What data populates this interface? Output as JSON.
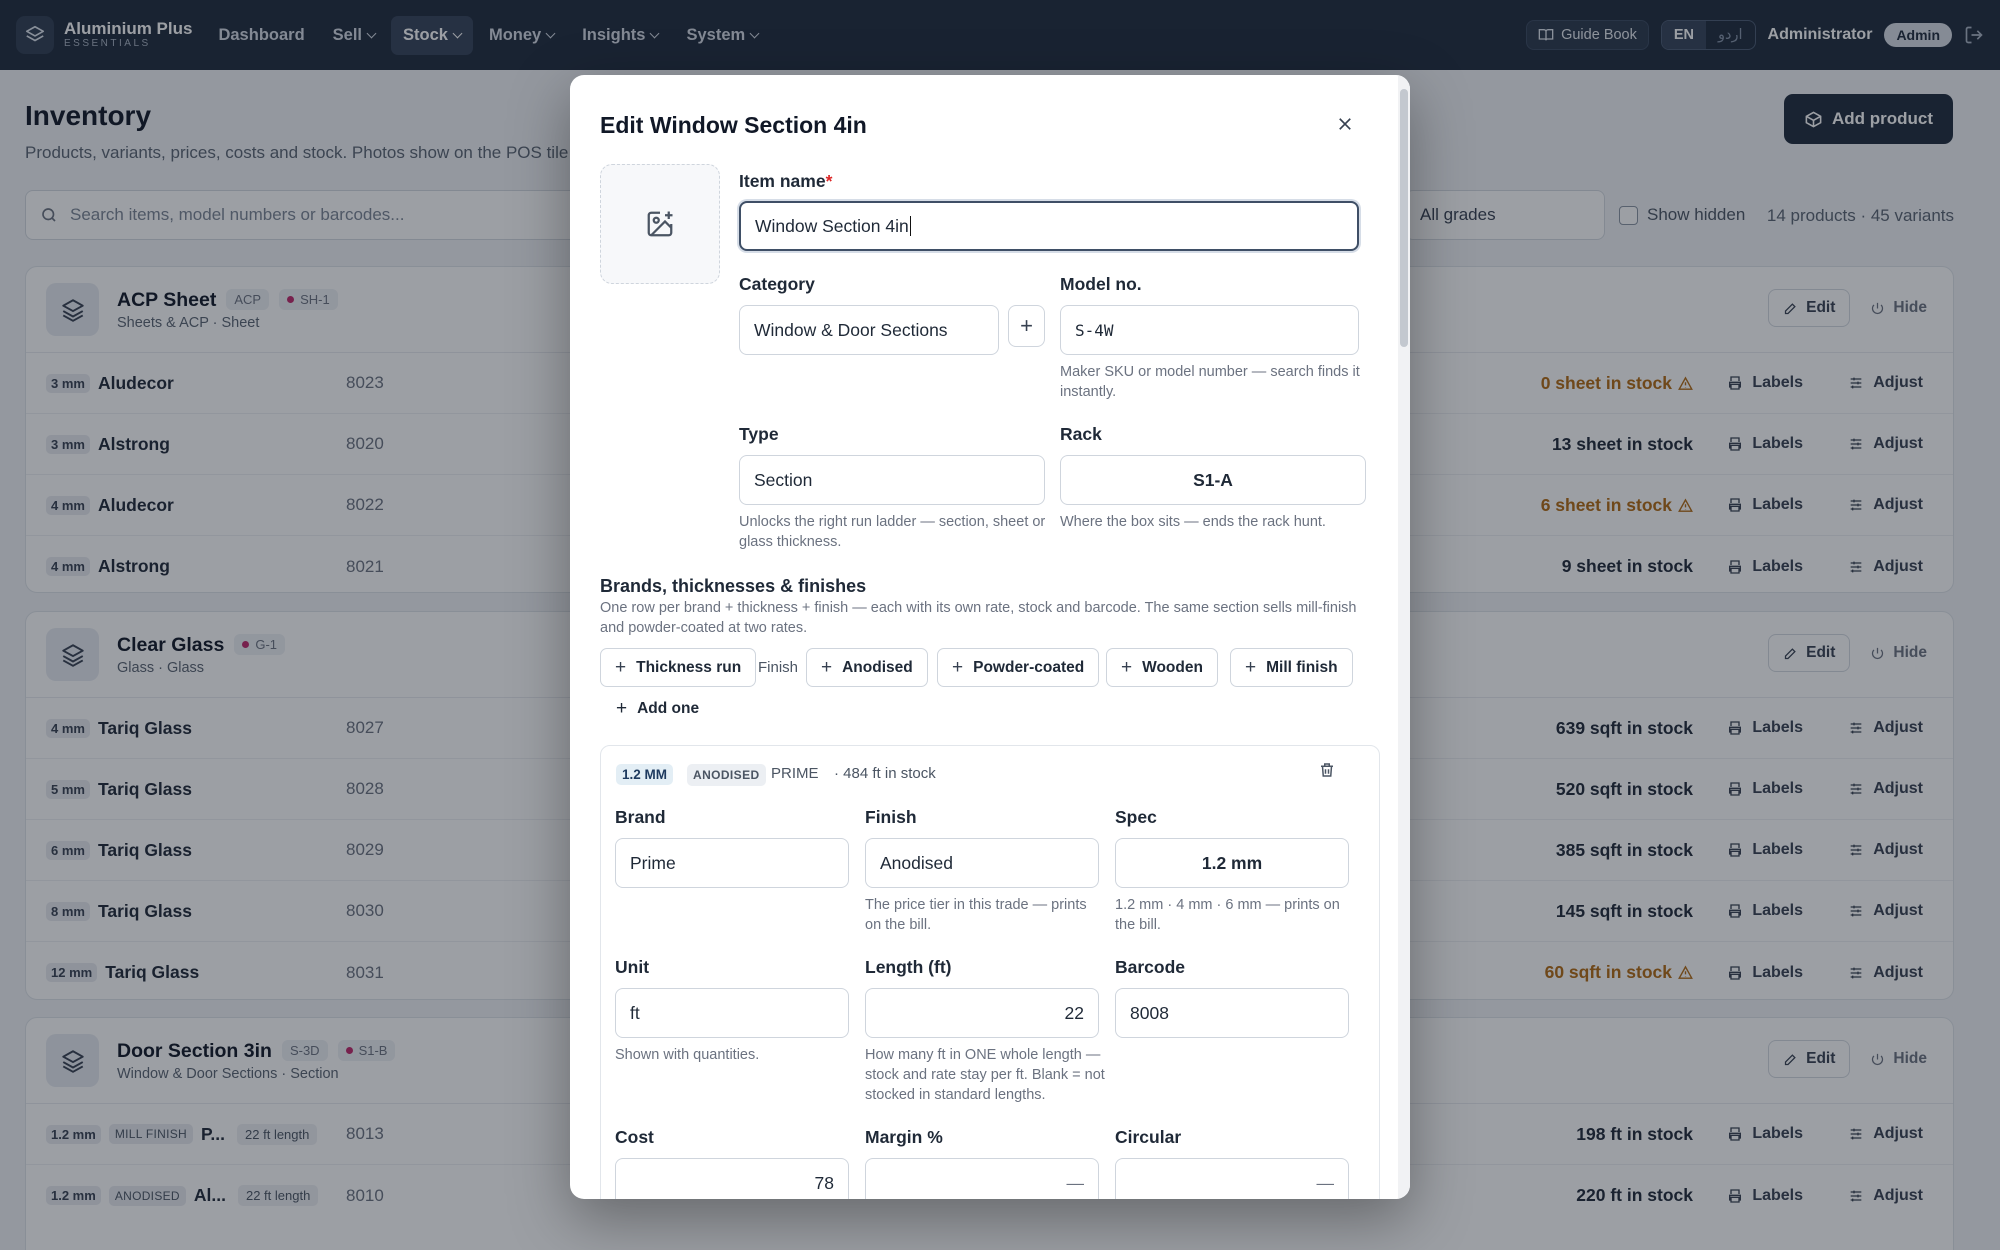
{
  "nav": {
    "brand_name": "Aluminium Plus",
    "brand_tag": "ESSENTIALS",
    "items": [
      {
        "label": "Dashboard",
        "dropdown": false,
        "active": false
      },
      {
        "label": "Sell",
        "dropdown": true,
        "active": false
      },
      {
        "label": "Stock",
        "dropdown": true,
        "active": true
      },
      {
        "label": "Money",
        "dropdown": true,
        "active": false
      },
      {
        "label": "Insights",
        "dropdown": true,
        "active": false
      },
      {
        "label": "System",
        "dropdown": true,
        "active": false
      }
    ],
    "guide_label": "Guide Book",
    "lang_en": "EN",
    "lang_ur": "اردو",
    "user_name": "Administrator",
    "role": "Admin"
  },
  "page": {
    "title": "Inventory",
    "subtitle": "Products, variants, prices, costs and stock. Photos show on the POS tile",
    "add_label": "Add product",
    "search_placeholder": "Search items, model numbers or barcodes...",
    "grade_filter": "All grades",
    "show_hidden_label": "Show hidden",
    "counts": "14 products · 45 variants"
  },
  "common": {
    "edit": "Edit",
    "hide": "Hide",
    "labels": "Labels",
    "adjust": "Adjust"
  },
  "products": [
    {
      "name": "ACP Sheet",
      "tag": "ACP",
      "rack": "SH-1",
      "meta": "Sheets & ACP · Sheet",
      "variants": [
        {
          "thick": "3 mm",
          "name": "Aludecor",
          "code": "8023",
          "stock": "0 sheet in stock",
          "warn": true
        },
        {
          "thick": "3 mm",
          "name": "Alstrong",
          "code": "8020",
          "stock": "13 sheet in stock",
          "warn": false
        },
        {
          "thick": "4 mm",
          "name": "Aludecor",
          "code": "8022",
          "stock": "6 sheet in stock",
          "warn": true
        },
        {
          "thick": "4 mm",
          "name": "Alstrong",
          "code": "8021",
          "stock": "9 sheet in stock",
          "warn": false
        }
      ]
    },
    {
      "name": "Clear Glass",
      "tag": "",
      "rack": "G-1",
      "meta": "Glass · Glass",
      "variants": [
        {
          "thick": "4 mm",
          "name": "Tariq Glass",
          "code": "8027",
          "stock": "639 sqft in stock",
          "warn": false
        },
        {
          "thick": "5 mm",
          "name": "Tariq Glass",
          "code": "8028",
          "stock": "520 sqft in stock",
          "warn": false
        },
        {
          "thick": "6 mm",
          "name": "Tariq Glass",
          "code": "8029",
          "stock": "385 sqft in stock",
          "warn": false
        },
        {
          "thick": "8 mm",
          "name": "Tariq Glass",
          "code": "8030",
          "stock": "145 sqft in stock",
          "warn": false
        },
        {
          "thick": "12 mm",
          "name": "Tariq Glass",
          "code": "8031",
          "stock": "60 sqft in stock",
          "warn": true
        }
      ]
    },
    {
      "name": "Door Section 3in",
      "tag": "S-3D",
      "rack": "S1-B",
      "meta": "Window & Door Sections · Section",
      "variants": [
        {
          "thick": "1.2 mm",
          "finish": "MILL FINISH",
          "name": "P...",
          "len": "22 ft length",
          "code": "8013",
          "stock": "198 ft in stock",
          "warn": false
        },
        {
          "thick": "1.2 mm",
          "finish": "ANODISED",
          "name": "Al...",
          "len": "22 ft length",
          "code": "8010",
          "stock": "220 ft in stock",
          "warn": false
        }
      ]
    }
  ],
  "modal": {
    "title": "Edit Window Section 4in",
    "item_name_label": "Item name",
    "item_name_required": "*",
    "item_name_value": "Window Section 4in",
    "category_label": "Category",
    "category_value": "Window & Door Sections",
    "add_category": "+",
    "model_label": "Model no.",
    "model_value": "S-4W",
    "model_help": "Maker SKU or model number — search finds it instantly.",
    "type_label": "Type",
    "type_value": "Section",
    "type_help": "Unlocks the right run ladder — section, sheet or glass thickness.",
    "rack_label": "Rack",
    "rack_value": "S1-A",
    "rack_help": "Where the box sits — ends the rack hunt.",
    "section_title": "Brands, thicknesses & finishes",
    "section_help": "One row per brand + thickness + finish — each with its own rate, stock and barcode. The same section sells mill-finish and powder-coated at two rates.",
    "thickness_run": "Thickness run",
    "finish_label": "Finish",
    "finish_options": [
      "Anodised",
      "Powder-coated",
      "Wooden",
      "Mill finish"
    ],
    "add_one": "Add one",
    "variant": {
      "thickness_tag": "1.2 MM",
      "finish_tag": "ANODISED",
      "brand_tag": "PRIME",
      "stock": "· 484 ft in stock",
      "brand_label": "Brand",
      "brand_value": "Prime",
      "finish_label": "Finish",
      "finish_value": "Anodised",
      "finish_help": "The price tier in this trade — prints on the bill.",
      "spec_label": "Spec",
      "spec_value": "1.2 mm",
      "spec_help": "1.2 mm · 4 mm · 6 mm — prints on the bill.",
      "unit_label": "Unit",
      "unit_value": "ft",
      "unit_help": "Shown with quantities.",
      "length_label": "Length (ft)",
      "length_value": "22",
      "length_help": "How many ft in ONE whole length — stock and rate stay per ft. Blank = not stocked in standard lengths.",
      "barcode_label": "Barcode",
      "barcode_value": "8008",
      "cost_label": "Cost",
      "cost_value": "78",
      "margin_label": "Margin %",
      "margin_value": "—",
      "circular_label": "Circular",
      "circular_value": "—"
    }
  },
  "colors": {
    "nav_bg": "#1e2a3b",
    "warn": "#b26a12",
    "rack_dot": "#c0276a"
  }
}
